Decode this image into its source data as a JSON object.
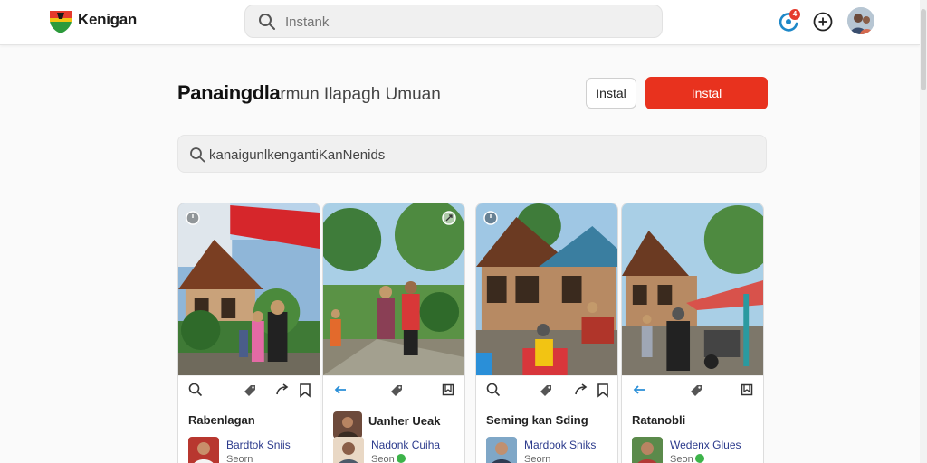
{
  "app": {
    "brand": "Kenigan",
    "search_placeholder": "Instank",
    "notification_count": "4"
  },
  "header": {
    "title_strong": "Panaingdla",
    "title_light": "rmun Ilapagh Umuan",
    "outline_button": "Instal",
    "primary_button": "Instal",
    "search_value": "kanaigunlkengantiKanNenids"
  },
  "colors": {
    "accent": "#e8321e",
    "link": "#2b3a8c",
    "status_green": "#3db34a"
  },
  "cards": [
    {
      "title": "Rabenlagan",
      "user_name": "Bardtok Sniis",
      "user_sub": "Seorn",
      "corner_icon": "timer-icon",
      "first_action": "search-icon"
    },
    {
      "title": "Uanher Ueak",
      "user_name": "Nadonk Cuiha",
      "user_sub": "Seon",
      "corner_icon": "expand-icon",
      "first_action": "back-arrow-icon"
    },
    {
      "title": "Seming kan Sding",
      "user_name": "Mardook Sniks",
      "user_sub": "Seorn",
      "corner_icon": "timer-icon",
      "first_action": "search-icon"
    },
    {
      "title": "Ratanobli",
      "user_name": "Wedenx Glues",
      "user_sub": "Seon",
      "corner_icon": "none",
      "first_action": "back-arrow-icon"
    }
  ]
}
